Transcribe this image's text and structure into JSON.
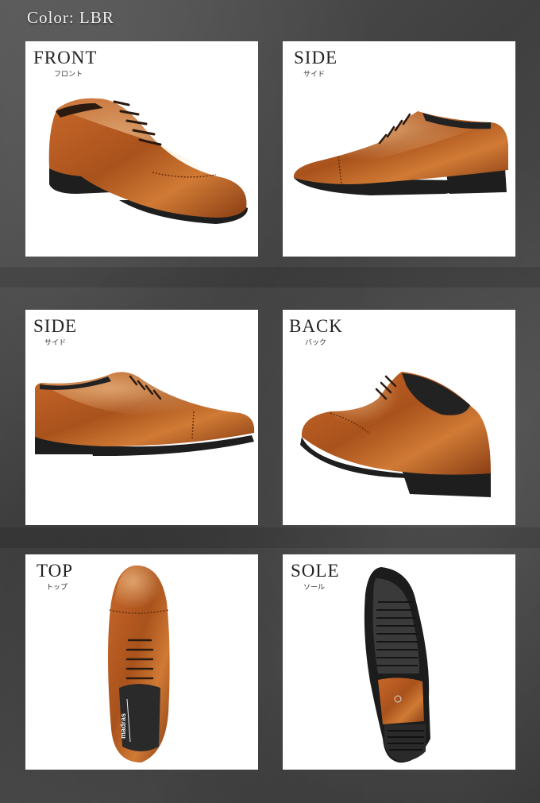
{
  "header": {
    "color_label": "Color: LBR"
  },
  "panels": [
    {
      "title": "FRONT",
      "subtitle": "フロント"
    },
    {
      "title": "SIDE",
      "subtitle": "サイド"
    },
    {
      "title": "SIDE",
      "subtitle": "サイド"
    },
    {
      "title": "BACK",
      "subtitle": "バック"
    },
    {
      "title": "TOP",
      "subtitle": "トップ"
    },
    {
      "title": "SOLE",
      "subtitle": "ソール"
    }
  ],
  "brand": {
    "insole_text": "madras"
  },
  "colors": {
    "leather": "#b5561f",
    "leather_dark": "#7a3410",
    "sole": "#222222",
    "background": "#4a4a4a"
  }
}
